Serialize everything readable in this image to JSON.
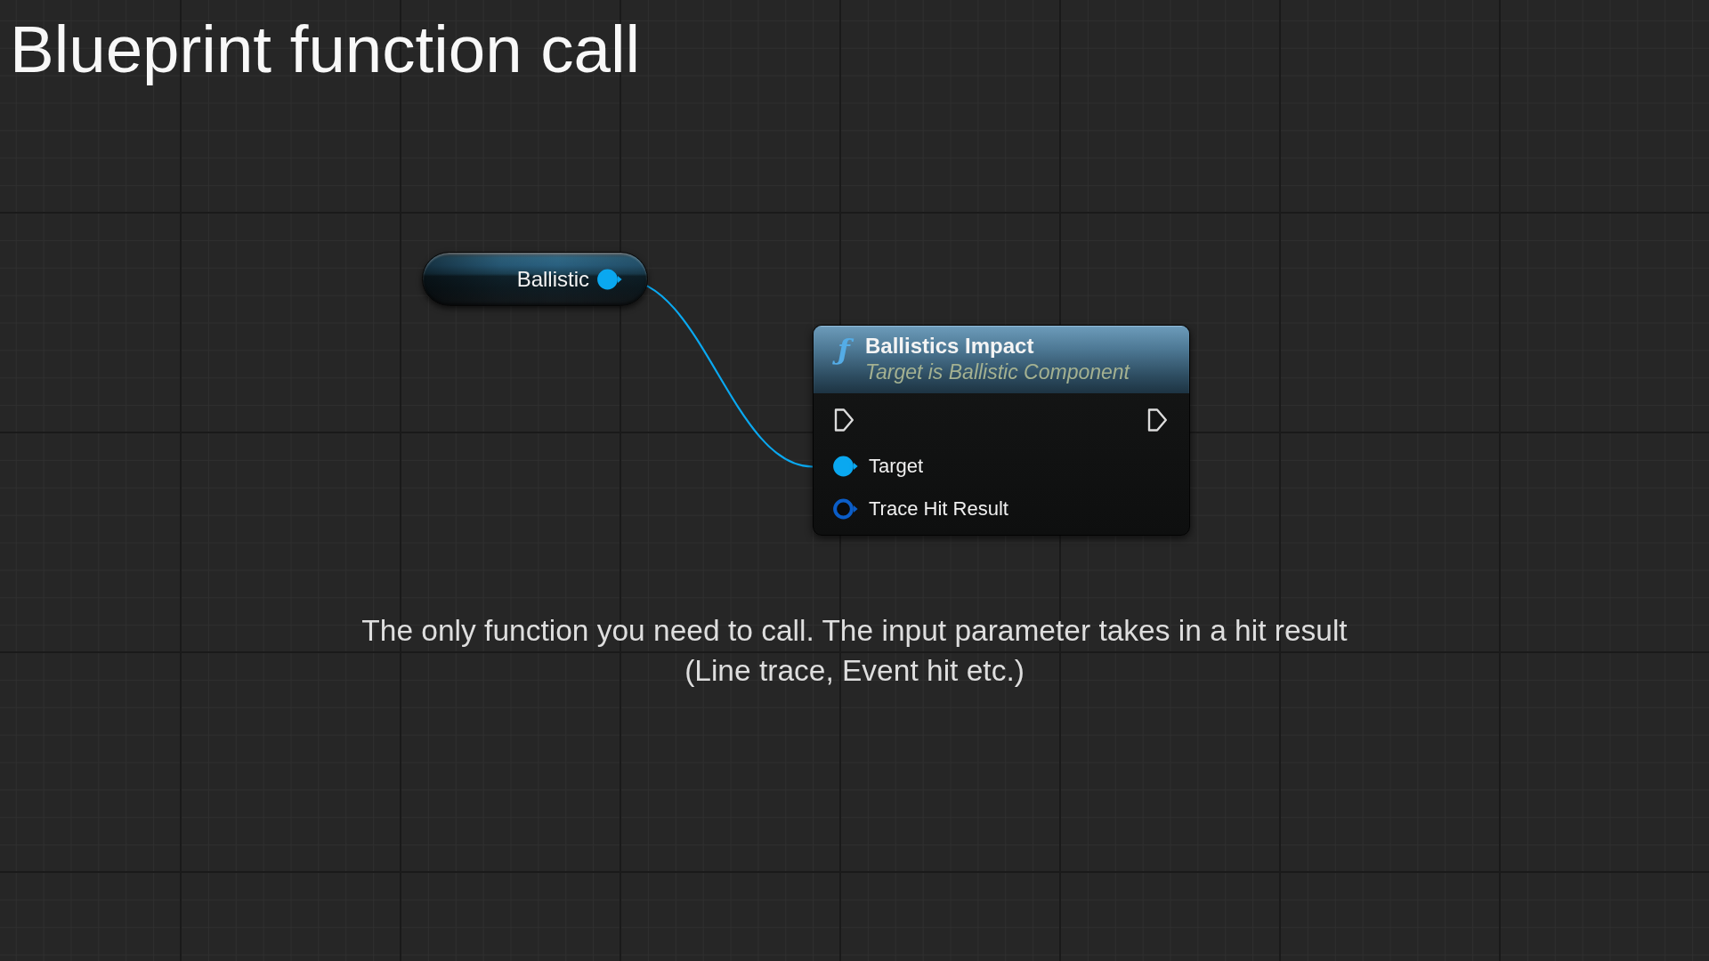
{
  "title": "Blueprint function call",
  "graph": {
    "nodes": [
      {
        "kind": "variable",
        "label": "Ballistic",
        "output_pin": {
          "color": "#0aa8f0",
          "connected": true
        }
      },
      {
        "kind": "function",
        "icon": "ƒ",
        "title": "Ballistics Impact",
        "subtitle": "Target is Ballistic Component",
        "exec_in": {
          "connected": false
        },
        "exec_out": {
          "connected": false
        },
        "inputs": [
          {
            "label": "Target",
            "color": "#0aa8f0",
            "connected": true
          },
          {
            "label": "Trace Hit Result",
            "color": "#0b5dc7",
            "connected": false
          }
        ]
      }
    ]
  },
  "caption": "The only function you need to call. The input parameter takes in a hit result (Line trace, Event hit etc.)"
}
